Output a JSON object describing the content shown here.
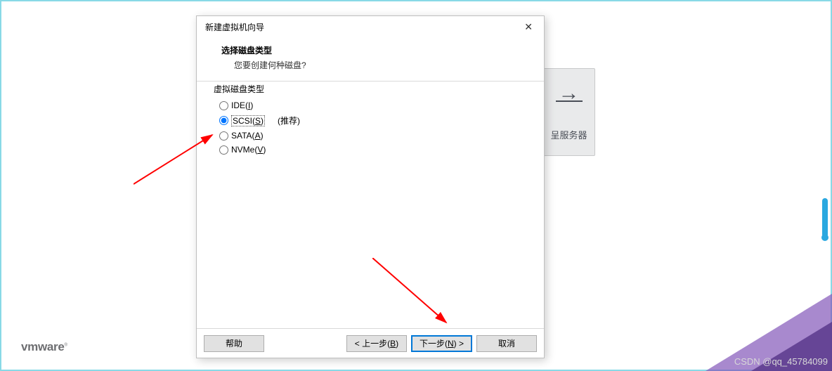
{
  "dialog": {
    "title": "新建虚拟机向导",
    "header_title": "选择磁盘类型",
    "header_sub": "您要创建何种磁盘?",
    "group_title": "虚拟磁盘类型",
    "options": {
      "ide": "IDE(I)",
      "scsi": "SCSI(S)",
      "sata": "SATA(A)",
      "nvme": "NVMe(V)"
    },
    "recommend": "(推荐)",
    "buttons": {
      "help": "帮助",
      "back": "< 上一步(B)",
      "next": "下一步(N) >",
      "cancel": "取消"
    }
  },
  "background": {
    "card_text": "呈服务器",
    "logo": "vmware"
  },
  "watermark": "CSDN @qq_45784099"
}
